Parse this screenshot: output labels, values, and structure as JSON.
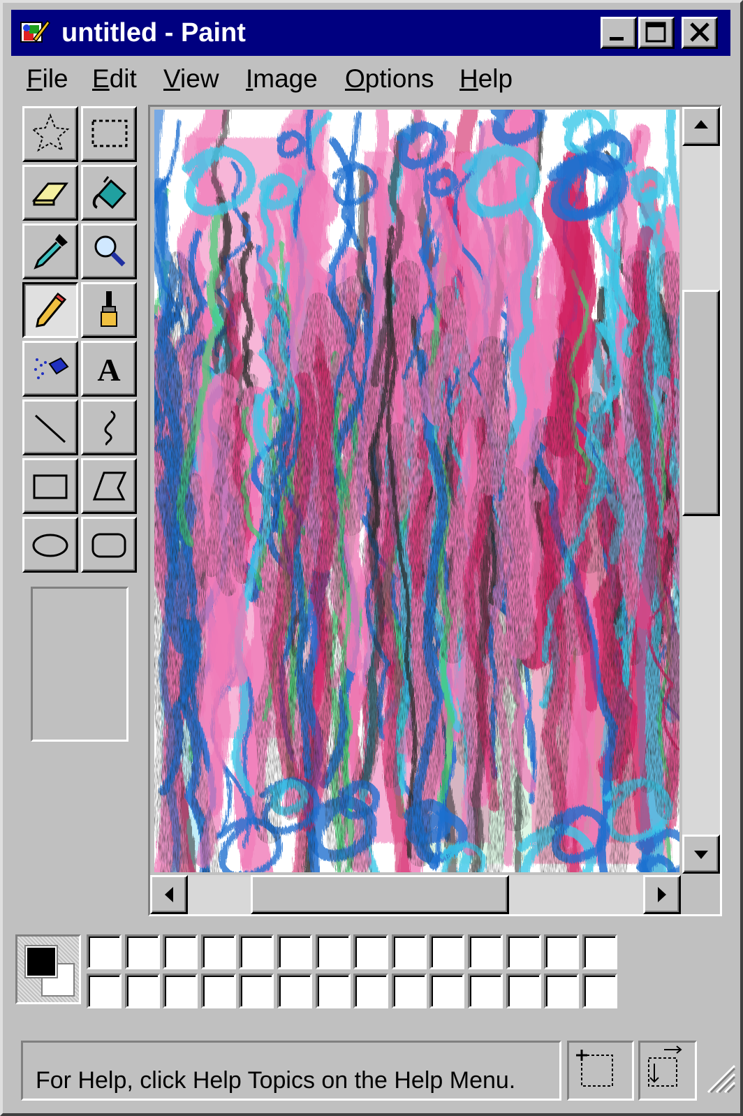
{
  "window": {
    "title": "untitled - Paint",
    "title_bar_color": "#000080",
    "controls": [
      "minimize",
      "maximize",
      "close"
    ]
  },
  "menu": [
    {
      "label": "File",
      "mnemonic": "F"
    },
    {
      "label": "Edit",
      "mnemonic": "E"
    },
    {
      "label": "View",
      "mnemonic": "V"
    },
    {
      "label": "Image",
      "mnemonic": "I"
    },
    {
      "label": "Options",
      "mnemonic": "O"
    },
    {
      "label": "Help",
      "mnemonic": "H"
    }
  ],
  "toolbox": {
    "tools": [
      {
        "name": "free-form-select",
        "icon": "star-select-icon"
      },
      {
        "name": "select",
        "icon": "rect-select-icon"
      },
      {
        "name": "eraser",
        "icon": "eraser-icon"
      },
      {
        "name": "fill-with-color",
        "icon": "paint-bucket-icon"
      },
      {
        "name": "pick-color",
        "icon": "eyedropper-icon"
      },
      {
        "name": "magnifier",
        "icon": "magnifier-icon"
      },
      {
        "name": "pencil",
        "icon": "pencil-icon",
        "selected": true
      },
      {
        "name": "brush",
        "icon": "brush-icon"
      },
      {
        "name": "airbrush",
        "icon": "airbrush-icon"
      },
      {
        "name": "text",
        "icon": "text-icon"
      },
      {
        "name": "line",
        "icon": "line-icon"
      },
      {
        "name": "curve",
        "icon": "curve-icon"
      },
      {
        "name": "rectangle",
        "icon": "rectangle-icon"
      },
      {
        "name": "polygon",
        "icon": "polygon-icon"
      },
      {
        "name": "ellipse",
        "icon": "ellipse-icon"
      },
      {
        "name": "rounded-rectangle",
        "icon": "rounded-rectangle-icon"
      }
    ]
  },
  "canvas": {
    "content": "abstract painting",
    "colors": [
      "#f07ab8",
      "#1e6fd0",
      "#3cc8e8",
      "#2a2a2a",
      "#40d070",
      "#d02060",
      "#ffffff"
    ]
  },
  "palette": {
    "foreground": "#000000",
    "background": "#ffffff",
    "swatches": [
      "#ffffff",
      "#ffffff",
      "#ffffff",
      "#ffffff",
      "#ffffff",
      "#ffffff",
      "#ffffff",
      "#ffffff",
      "#ffffff",
      "#ffffff",
      "#ffffff",
      "#ffffff",
      "#ffffff",
      "#ffffff",
      "#ffffff",
      "#ffffff",
      "#ffffff",
      "#ffffff",
      "#ffffff",
      "#ffffff",
      "#ffffff",
      "#ffffff",
      "#ffffff",
      "#ffffff",
      "#ffffff",
      "#ffffff",
      "#ffffff",
      "#ffffff"
    ]
  },
  "status": {
    "help_text": "For Help, click Help Topics on the Help Menu."
  }
}
